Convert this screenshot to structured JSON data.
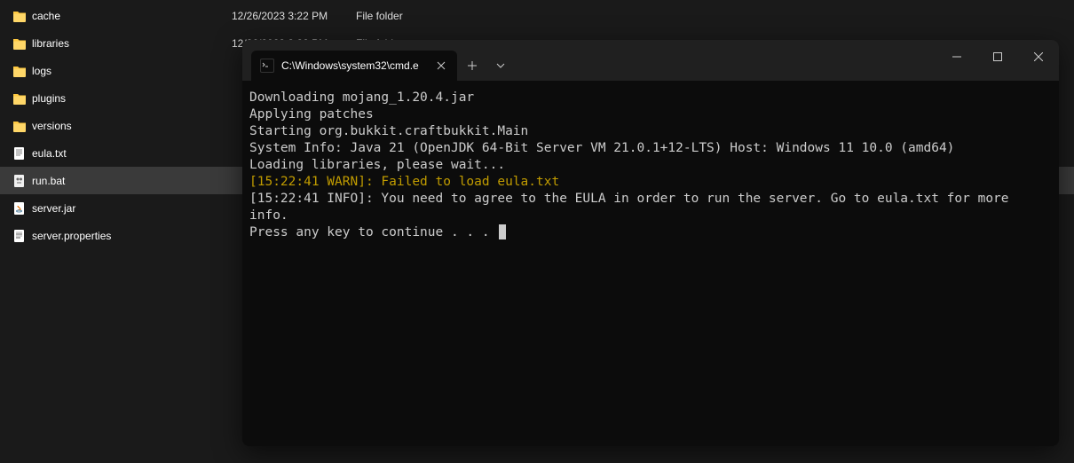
{
  "files": [
    {
      "icon": "folder",
      "name": "cache",
      "date": "12/26/2023 3:22 PM",
      "type": "File folder"
    },
    {
      "icon": "folder",
      "name": "libraries",
      "date": "12/26/2023 3:22 PM",
      "type": "File folder"
    },
    {
      "icon": "folder",
      "name": "logs",
      "date": "",
      "type": ""
    },
    {
      "icon": "folder",
      "name": "plugins",
      "date": "",
      "type": ""
    },
    {
      "icon": "folder",
      "name": "versions",
      "date": "",
      "type": ""
    },
    {
      "icon": "txt",
      "name": "eula.txt",
      "date": "",
      "type": ""
    },
    {
      "icon": "bat",
      "name": "run.bat",
      "date": "",
      "type": "",
      "selected": true
    },
    {
      "icon": "jar",
      "name": "server.jar",
      "date": "",
      "type": ""
    },
    {
      "icon": "prop",
      "name": "server.properties",
      "date": "",
      "type": ""
    }
  ],
  "terminal": {
    "tab_title": "C:\\Windows\\system32\\cmd.e",
    "lines": [
      {
        "text": "Downloading mojang_1.20.4.jar",
        "class": ""
      },
      {
        "text": "Applying patches",
        "class": ""
      },
      {
        "text": "Starting org.bukkit.craftbukkit.Main",
        "class": ""
      },
      {
        "text": "System Info: Java 21 (OpenJDK 64-Bit Server VM 21.0.1+12-LTS) Host: Windows 11 10.0 (amd64)",
        "class": ""
      },
      {
        "text": "Loading libraries, please wait...",
        "class": ""
      },
      {
        "text": "[15:22:41 WARN]: Failed to load eula.txt",
        "class": "term-warn"
      },
      {
        "text": "[15:22:41 INFO]: You need to agree to the EULA in order to run the server. Go to eula.txt for more info.",
        "class": ""
      }
    ],
    "prompt": "Press any key to continue . . . "
  }
}
